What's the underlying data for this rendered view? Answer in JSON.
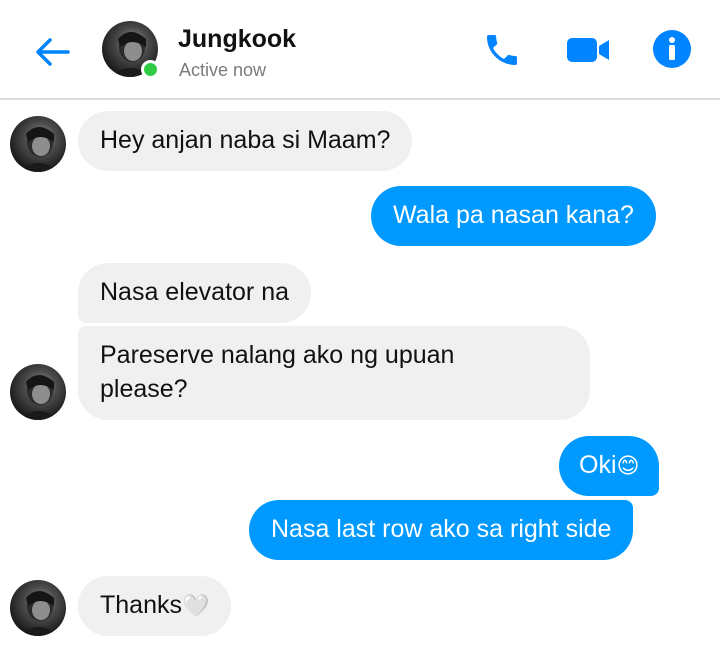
{
  "header": {
    "contact_name": "Jungkook",
    "status": "Active now",
    "back_icon": "arrow-left-icon",
    "call_icon": "phone-icon",
    "video_icon": "video-camera-icon",
    "info_icon": "info-icon",
    "accent_color": "#0084ff",
    "online_color": "#31cc46"
  },
  "messages": [
    {
      "side": "received",
      "text": "Hey anjan naba si Maam?"
    },
    {
      "side": "sent",
      "text": "Wala pa nasan kana?"
    },
    {
      "side": "received",
      "text": "Nasa elevator na"
    },
    {
      "side": "received",
      "lines": [
        "Pareserve nalang ako ng upuan",
        "please?"
      ]
    },
    {
      "side": "sent",
      "text": "Oki",
      "emoji": "😊"
    },
    {
      "side": "sent",
      "text": "Nasa last row ako sa right side"
    },
    {
      "side": "received",
      "text": "Thanks",
      "emoji": "🤍"
    }
  ],
  "colors": {
    "sent_bubble": "#0099ff",
    "received_bubble": "#f1f0f0"
  }
}
